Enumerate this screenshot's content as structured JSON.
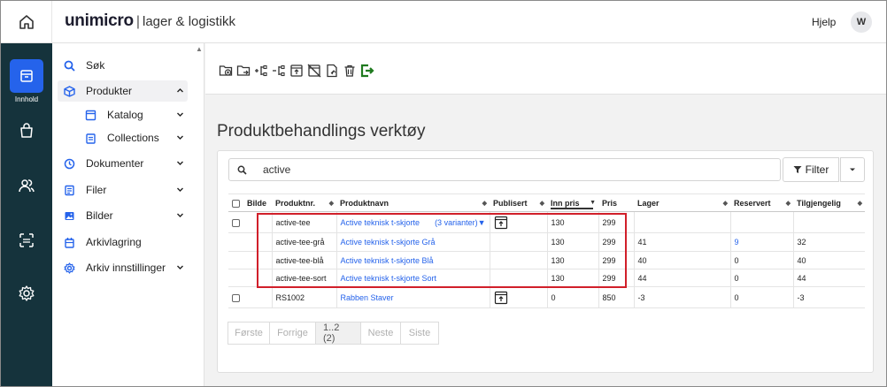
{
  "brand": {
    "name": "unimicro",
    "separator": "|",
    "module": "lager & logistikk"
  },
  "header": {
    "help": "Hjelp",
    "user_initial": "W"
  },
  "rail": {
    "active_label": "Innhold"
  },
  "nav": {
    "items": [
      {
        "label": "Søk"
      },
      {
        "label": "Produkter"
      },
      {
        "label": "Katalog"
      },
      {
        "label": "Collections"
      },
      {
        "label": "Dokumenter"
      },
      {
        "label": "Filer"
      },
      {
        "label": "Bilder"
      },
      {
        "label": "Arkivlagring"
      },
      {
        "label": "Arkiv innstillinger"
      }
    ]
  },
  "page": {
    "title": "Produktbehandlings verktøy"
  },
  "search": {
    "value": "active"
  },
  "filter": {
    "label": "Filter"
  },
  "table": {
    "columns": [
      "Bilde",
      "Produktnr.",
      "Produktnavn",
      "Publisert",
      "Inn pris",
      "Pris",
      "Lager",
      "Reservert",
      "Tilgjengelig"
    ],
    "rows": [
      {
        "produktnr": "active-tee",
        "navn": "Active teknisk t-skjorte",
        "variants": "(3 varianter)",
        "inn": "130",
        "pris": "299",
        "lager": "",
        "reservert": "",
        "tilgjengelig": ""
      },
      {
        "produktnr": "active-tee-grå",
        "navn": "Active teknisk t-skjorte Grå",
        "inn": "130",
        "pris": "299",
        "lager": "41",
        "reservert": "9",
        "tilgjengelig": "32"
      },
      {
        "produktnr": "active-tee-blå",
        "navn": "Active teknisk t-skjorte Blå",
        "inn": "130",
        "pris": "299",
        "lager": "40",
        "reservert": "0",
        "tilgjengelig": "40"
      },
      {
        "produktnr": "active-tee-sort",
        "navn": "Active teknisk t-skjorte Sort",
        "inn": "130",
        "pris": "299",
        "lager": "44",
        "reservert": "0",
        "tilgjengelig": "44"
      },
      {
        "produktnr": "RS1002",
        "navn": "Rabben Staver",
        "inn": "0",
        "pris": "850",
        "lager": "-3",
        "reservert": "0",
        "tilgjengelig": "-3"
      }
    ]
  },
  "pager": {
    "first": "Første",
    "prev": "Forrige",
    "current": "1..2 (2)",
    "next": "Neste",
    "last": "Siste"
  },
  "colors": {
    "rail_bg": "#15333c",
    "accent": "#2563eb",
    "highlight": "#d11f2a",
    "export_green": "#1f7a1f"
  }
}
